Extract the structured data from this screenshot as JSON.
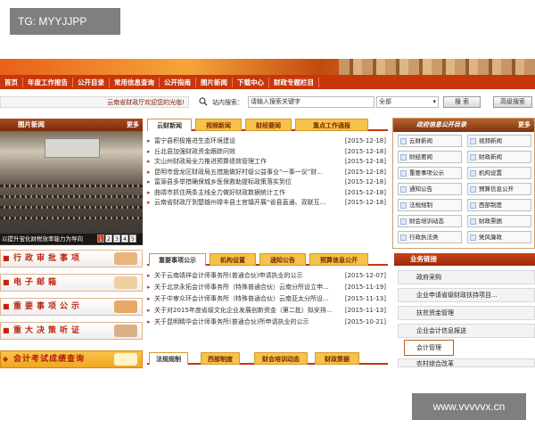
{
  "watermark_top": "TG: MYYJJPP",
  "watermark_bottom": "www.vvvvvx.cn",
  "nav": [
    "首页",
    "年度工作报告",
    "公开目录",
    "常用信息查询",
    "公开指南",
    "图片新闻",
    "下载中心",
    "财政专题栏目"
  ],
  "search": {
    "welcome": "云南省财政厅欢迎您的光临!",
    "site_label": "站内搜索：",
    "placeholder": "请输入搜索关键字",
    "scope": "全部",
    "search_btn": "搜 索",
    "advanced_btn": "高级搜索"
  },
  "photo_news": {
    "title": "图片新闻",
    "more": "更多",
    "caption": "以提升宝化财税效率能力为导向",
    "pages": [
      "1",
      "2",
      "3",
      "4",
      "5"
    ]
  },
  "left_buttons": [
    "行政审批事项",
    "电子邮箱",
    "重要事项公示",
    "重大决策听证",
    "会计考试成绩查询"
  ],
  "news_tabs": [
    "云财新闻",
    "视频新闻",
    "财经要闻",
    "重点工作通报"
  ],
  "news_items": [
    {
      "title": "富宁县积极推进生态环境建设",
      "date": "[2015-12-18]"
    },
    {
      "title": "丘北县加强财政资金跟踪问效",
      "date": "[2015-12-18]"
    },
    {
      "title": "文山州财政局全力推进预算绩效管理工作",
      "date": "[2015-12-18]"
    },
    {
      "title": "昆明市盘龙区财政局五措施做好村级公益事业“一事一议”财...",
      "date": "[2015-12-18]"
    },
    {
      "title": "富源县多举措确保城乡医保救助提标政策落实到位",
      "date": "[2015-12-18]"
    },
    {
      "title": "曲靖市抓住两条主线全力做好财政数据统计工作",
      "date": "[2015-12-18]"
    },
    {
      "title": "云南省财政厅到楚雄州禄丰县土官镇开展“省县直通、双联互...",
      "date": "[2015-12-18]"
    }
  ],
  "notice_tabs": [
    "重要事项公示",
    "机构设置",
    "通知公告",
    "预算信息公开"
  ],
  "notice_items": [
    {
      "title": "关于云南靖祥会计师事务所(普通合伙)申请执业的公示",
      "date": "[2015-12-07]"
    },
    {
      "title": "关于北京永拓会计师事务所（特殊普通合伙）云南分所设立申...",
      "date": "[2015-11-19]"
    },
    {
      "title": "关于中审众环会计师事务所（特殊普通合伙）云南亚太分所设...",
      "date": "[2015-11-13]"
    },
    {
      "title": "关于对2015年度省级文化企业发展创新资金（第二批）拟安排...",
      "date": "[2015-11-13]"
    },
    {
      "title": "关于昆明精华会计师事务所(普通合伙)所申请执业的公示",
      "date": "[2015-10-21]"
    }
  ],
  "bottom_tabs": [
    "法规规制",
    "西部制度",
    "财会培训动态",
    "财政票据"
  ],
  "gov_info": {
    "title": "政府信息公开目录",
    "more": "更多",
    "items": [
      "云财新闻",
      "视频新闻",
      "财经要闻",
      "财政新闻",
      "重要事项公示",
      "机构设置",
      "通知公告",
      "预算信息公开",
      "法规规制",
      "西部制度",
      "财会培训动态",
      "财政票据",
      "行政执法类",
      "党风廉政"
    ]
  },
  "business": {
    "title": "业务链接",
    "items": [
      "政府采购",
      "企业申请省级财政扶持项目...",
      "扶贫资金管理",
      "企业会计信息报送",
      "会计管理",
      "农村综合改革"
    ]
  }
}
